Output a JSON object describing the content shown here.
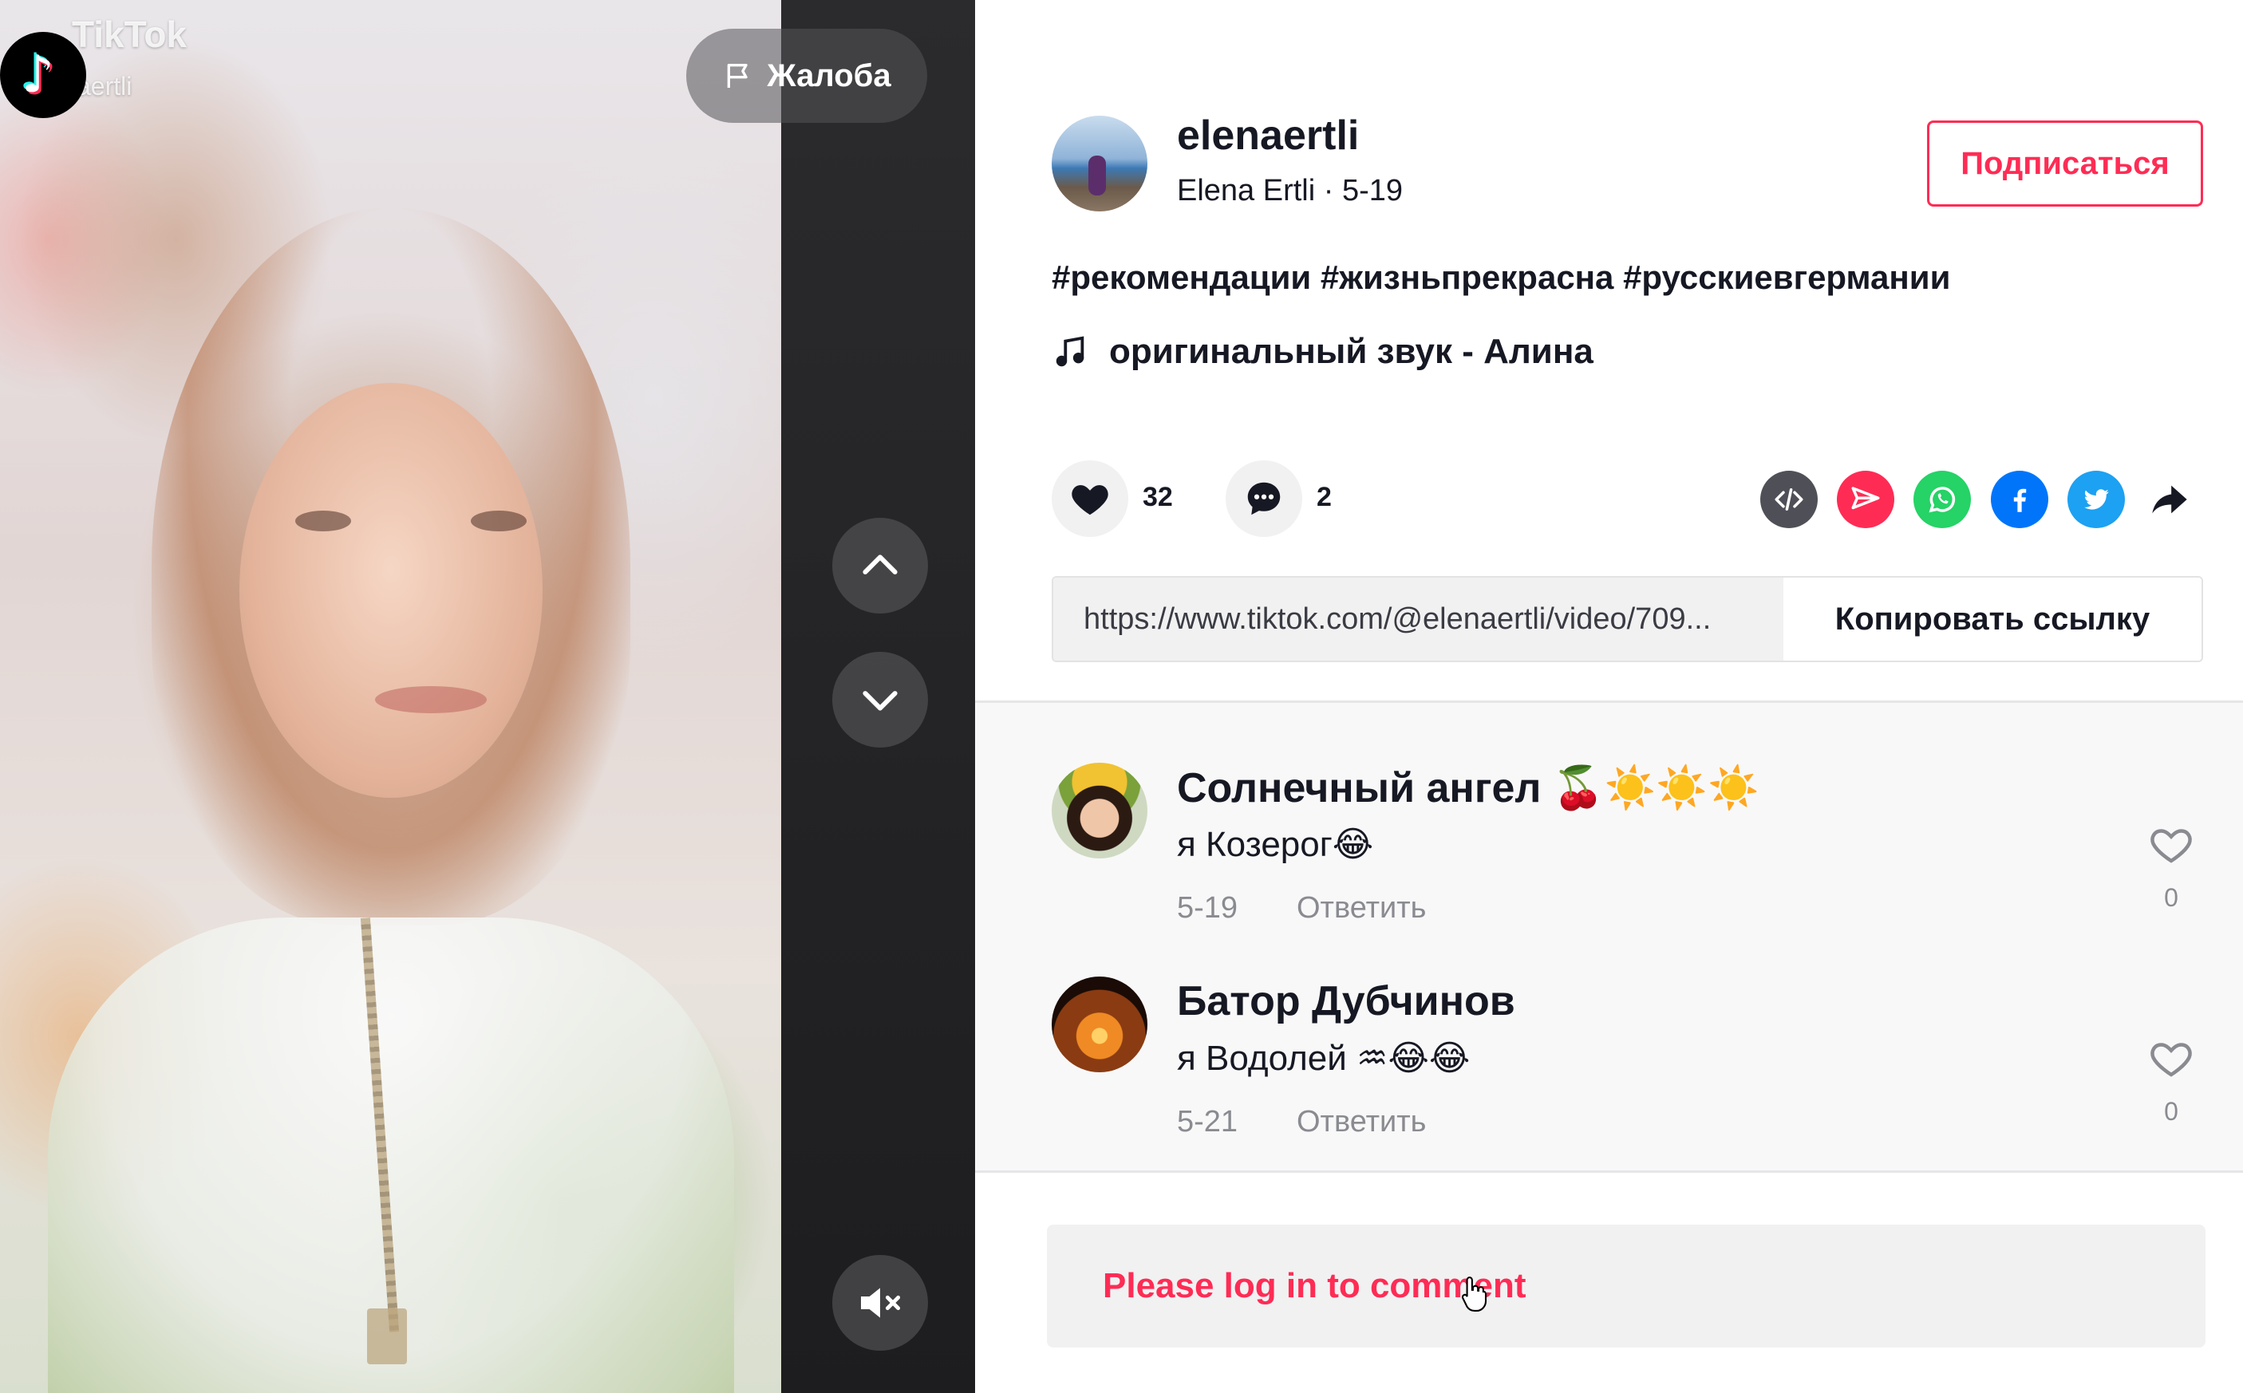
{
  "video": {
    "logo_text": "TikTok",
    "watermark_handle": "aertli",
    "report_label": "Жалоба"
  },
  "author": {
    "username": "elenaertli",
    "display_name": "Elena Ertli",
    "date": "5-19",
    "meta": "Elena Ertli · 5-19",
    "follow_label": "Подписаться"
  },
  "post": {
    "description": "#рекомендации #жизньпрекрасна #русскиевгермании",
    "music": "оригинальный звук - Алина",
    "likes": "32",
    "comments": "2",
    "share_icons": [
      "embed-icon",
      "telegram-icon",
      "whatsapp-icon",
      "facebook-icon",
      "twitter-icon",
      "share-arrow-icon"
    ],
    "link_url": "https://www.tiktok.com/@elenaertli/video/709...",
    "copy_link_label": "Копировать ссылку"
  },
  "comments": [
    {
      "name": "Солнечный ангел 🍒☀️☀️☀️",
      "text": "я Козерог😂",
      "date": "5-19",
      "reply_label": "Ответить",
      "likes": "0"
    },
    {
      "name": "Батор Дубчинов",
      "text": "я Водолей ♒😂😂",
      "date": "5-21",
      "reply_label": "Ответить",
      "likes": "0"
    }
  ],
  "login_prompt": "Please log in to comment",
  "colors": {
    "brand_red": "#fe2c55",
    "text_primary": "#161823",
    "text_secondary": "#8a8b91"
  }
}
